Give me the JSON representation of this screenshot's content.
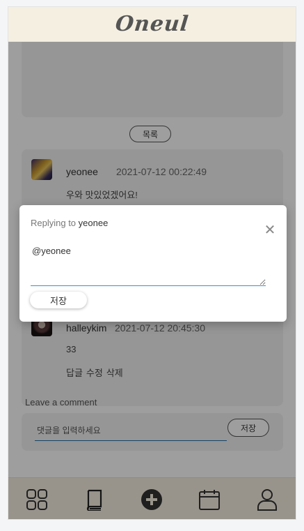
{
  "app": {
    "brand": "Oneul"
  },
  "post": {
    "list_button": "목록"
  },
  "comments": [
    {
      "user": "yeonee",
      "date": "2021-07-12 00:22:49",
      "text": "우와 맛있었겠어요!"
    },
    {
      "user": "halleykim",
      "date": "2021-07-12 20:45:30",
      "text": "33",
      "actions": [
        "답글",
        "수정",
        "삭제"
      ]
    }
  ],
  "comment_form": {
    "label": "Leave a comment",
    "placeholder": "댓글을 입력하세요",
    "save_label": "저장"
  },
  "reply_dialog": {
    "title_prefix": "Replying to",
    "reply_to": "yeonee",
    "text": "@yeonee",
    "save_label": "저장"
  },
  "bottom_nav": [
    {
      "icon": "grid-icon"
    },
    {
      "icon": "book-icon"
    },
    {
      "icon": "add-circle-icon"
    },
    {
      "icon": "calendar-icon"
    },
    {
      "icon": "user-icon"
    }
  ]
}
